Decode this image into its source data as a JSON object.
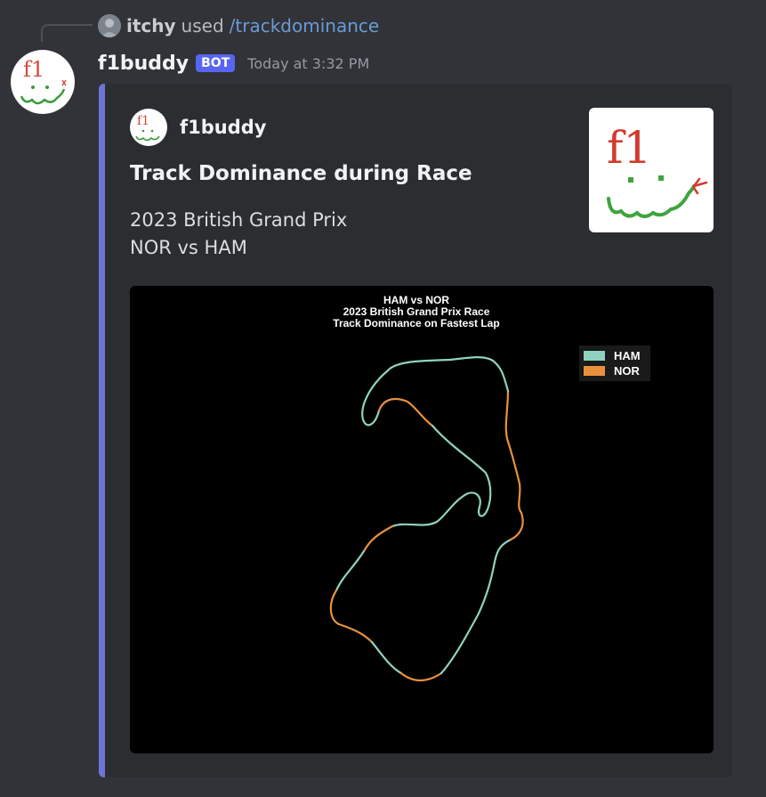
{
  "reply": {
    "username": "itchy",
    "used_text": "used",
    "command": "/trackdominance"
  },
  "message": {
    "username": "f1buddy",
    "bot_badge": "BOT",
    "timestamp": "Today at 3:32 PM"
  },
  "avatar_text": "f1",
  "embed": {
    "author": "f1buddy",
    "title": "Track Dominance during Race",
    "description_lines": [
      "2023 British Grand Prix",
      "NOR vs HAM"
    ],
    "thumbnail_text": "f1",
    "accent_color": "#6c74d8"
  },
  "chart_data": {
    "type": "track-map",
    "title_lines": [
      "HAM vs NOR",
      "2023 British Grand Prix Race",
      "Track Dominance on Fastest Lap"
    ],
    "legend": [
      {
        "name": "HAM",
        "color": "#8fd3bf"
      },
      {
        "name": "NOR",
        "color": "#e8913c"
      }
    ],
    "background": "#000000",
    "grid": false,
    "legend_position": "top-right"
  }
}
